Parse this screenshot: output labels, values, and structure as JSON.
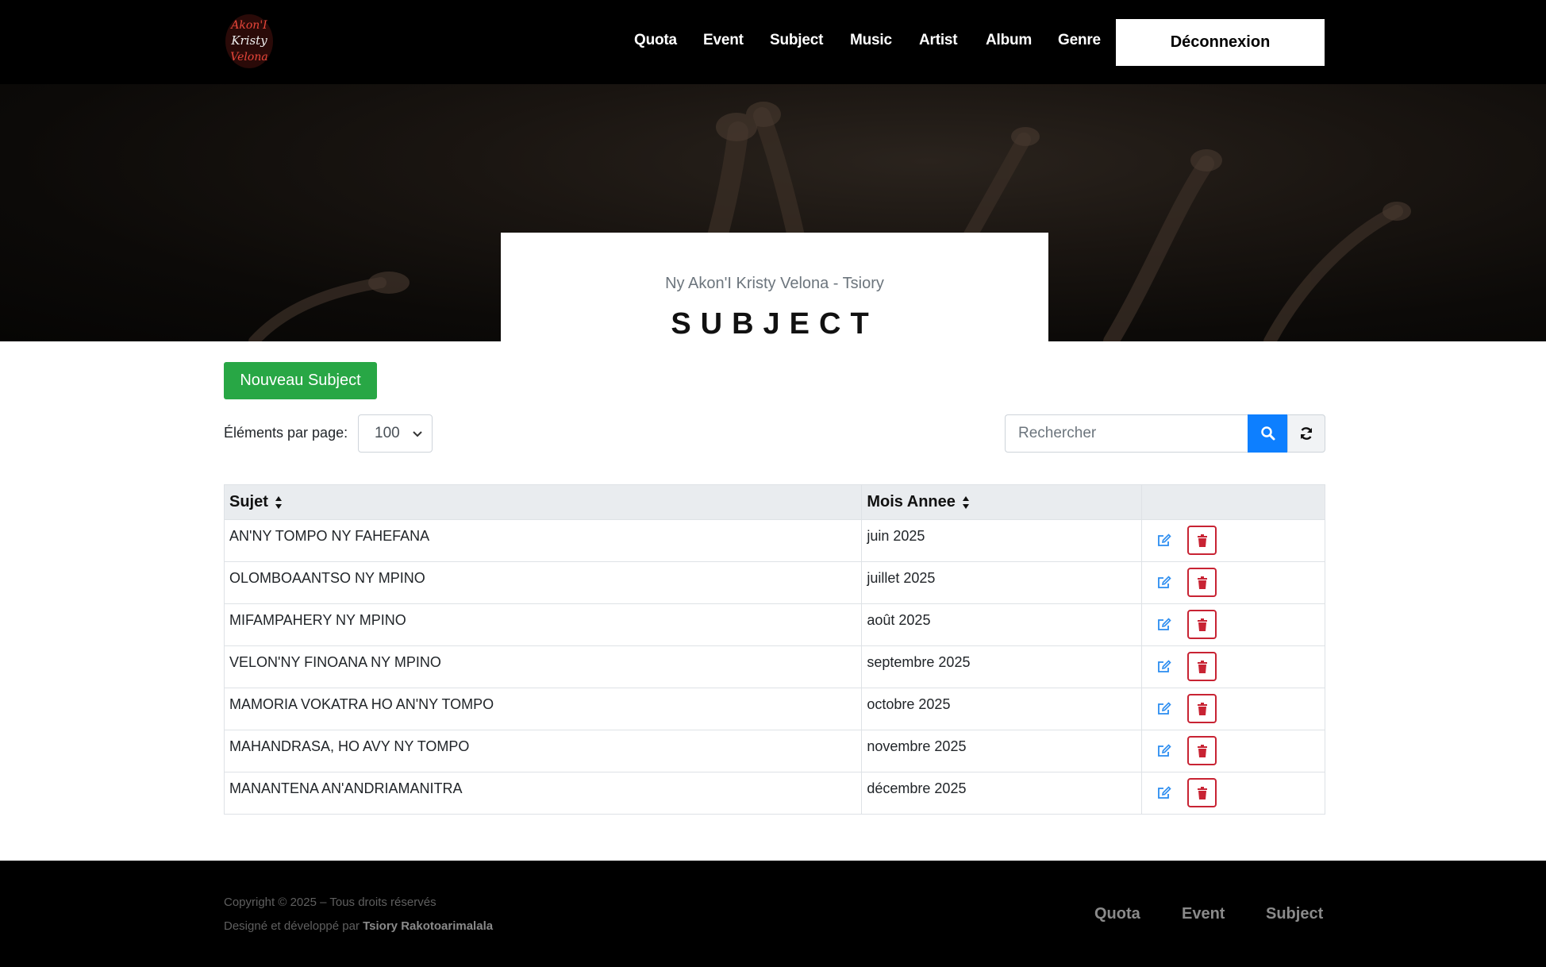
{
  "header": {
    "logo_text": "Ny Akon'I Kristy Velona",
    "nav": [
      "Quota",
      "Event",
      "Subject",
      "Music",
      "Artist",
      "Album",
      "Genre"
    ],
    "logout_label": "Déconnexion"
  },
  "hero": {
    "subtitle": "Ny Akon'I Kristy Velona - Tsiory",
    "title": "SUBJECT"
  },
  "toolbar": {
    "new_label": "Nouveau Subject",
    "per_page_label": "Éléments par page:",
    "per_page_value": "100",
    "search_placeholder": "Rechercher"
  },
  "table": {
    "headers": [
      "Sujet",
      "Mois Annee",
      ""
    ],
    "rows": [
      [
        "AN'NY TOMPO NY FAHEFANA",
        "juin 2025"
      ],
      [
        "OLOMBOAANTSO NY MPINO",
        "juillet 2025"
      ],
      [
        "MIFAMPAHERY NY MPINO",
        "août 2025"
      ],
      [
        "VELON'NY FINOANA NY MPINO",
        "septembre 2025"
      ],
      [
        "MAMORIA VOKATRA HO AN'NY TOMPO",
        "octobre 2025"
      ],
      [
        "MAHANDRASA, HO AVY NY TOMPO",
        "novembre 2025"
      ],
      [
        "MANANTENA AN'ANDRIAMANITRA",
        "décembre 2025"
      ]
    ]
  },
  "footer": {
    "copyright": "Copyright © 2025 – Tous droits réservés",
    "designed_prefix": "Designé et développé par ",
    "designer": "Tsiory Rakotoarimalala",
    "links": [
      "Quota",
      "Event",
      "Subject"
    ]
  },
  "colors": {
    "success": "#28a745",
    "primary": "#0d7fff",
    "danger": "#c82333",
    "header_bg": "#000000"
  }
}
